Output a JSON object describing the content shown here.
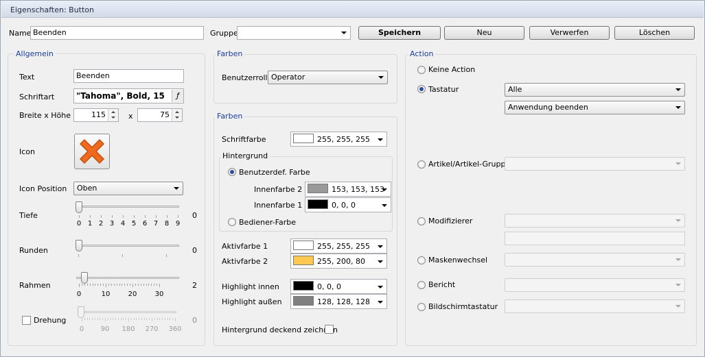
{
  "window": {
    "title": "Eigenschaften: Button"
  },
  "top": {
    "name_label": "Name",
    "name_value": "Beenden",
    "gruppe_label": "Gruppe",
    "gruppe_value": "",
    "buttons": {
      "save": "Speichern",
      "new": "Neu",
      "discard": "Verwerfen",
      "delete": "Löschen"
    }
  },
  "allgemein": {
    "title": "Allgemein",
    "text_label": "Text",
    "text_value": "Beenden",
    "font_label": "Schriftart",
    "font_value": "\"Tahoma\", Bold, 15",
    "font_button": "ƒ",
    "size_label": "Breite x Höhe",
    "width_value": "115",
    "x_label": "x",
    "height_value": "75",
    "icon_label": "Icon",
    "icon_name": "close-x-icon",
    "icon_position_label": "Icon Position",
    "icon_position_value": "Oben",
    "tiefe": {
      "label": "Tiefe",
      "value": "0",
      "ticks": [
        "0",
        "1",
        "2",
        "3",
        "4",
        "5",
        "6",
        "7",
        "8",
        "9"
      ]
    },
    "runden": {
      "label": "Runden",
      "value": "0"
    },
    "rahmen": {
      "label": "Rahmen",
      "value": "2",
      "ticks": [
        "0",
        "10",
        "20",
        "30"
      ]
    },
    "drehung": {
      "label": "Drehung",
      "value": "0",
      "checked": false,
      "ticks": [
        "0",
        "90",
        "180",
        "270",
        "360"
      ]
    }
  },
  "farben1": {
    "title": "Farben",
    "role_label": "Benutzerrolle",
    "role_value": "Operator"
  },
  "farben2": {
    "title": "Farben",
    "schriftfarbe_label": "Schriftfarbe",
    "schriftfarbe_value": "255, 255, 255",
    "schriftfarbe_color": "#ffffff",
    "hintergrund_title": "Hintergrund",
    "radio_custom": "Benutzerdef. Farbe",
    "innen2_label": "Innenfarbe 2",
    "innen2_value": "153, 153, 153",
    "innen2_color": "#999999",
    "innen1_label": "Innenfarbe 1",
    "innen1_value": "0, 0, 0",
    "innen1_color": "#000000",
    "radio_operator": "Bediener-Farbe",
    "aktiv1_label": "Aktivfarbe 1",
    "aktiv1_value": "255, 255, 255",
    "aktiv1_color": "#ffffff",
    "aktiv2_label": "Aktivfarbe 2",
    "aktiv2_value": "255, 200, 80",
    "aktiv2_color": "#ffc850",
    "hl_innen_label": "Highlight innen",
    "hl_innen_value": "0, 0, 0",
    "hl_innen_color": "#000000",
    "hl_aussen_label": "Highlight außen",
    "hl_aussen_value": "128, 128, 128",
    "hl_aussen_color": "#808080",
    "opaque_label": "Hintergrund deckend zeichnen",
    "opaque_checked": false
  },
  "action": {
    "title": "Action",
    "keine": "Keine Action",
    "tastatur": "Tastatur",
    "tastatur_select1": "Alle",
    "tastatur_select2": "Anwendung beenden",
    "artikel": "Artikel/Artikel-Gruppe",
    "modifizierer": "Modifizierer",
    "maskenwechsel": "Maskenwechsel",
    "bericht": "Bericht",
    "bildschirm": "Bildschirmtastatur",
    "selected": "tastatur"
  }
}
